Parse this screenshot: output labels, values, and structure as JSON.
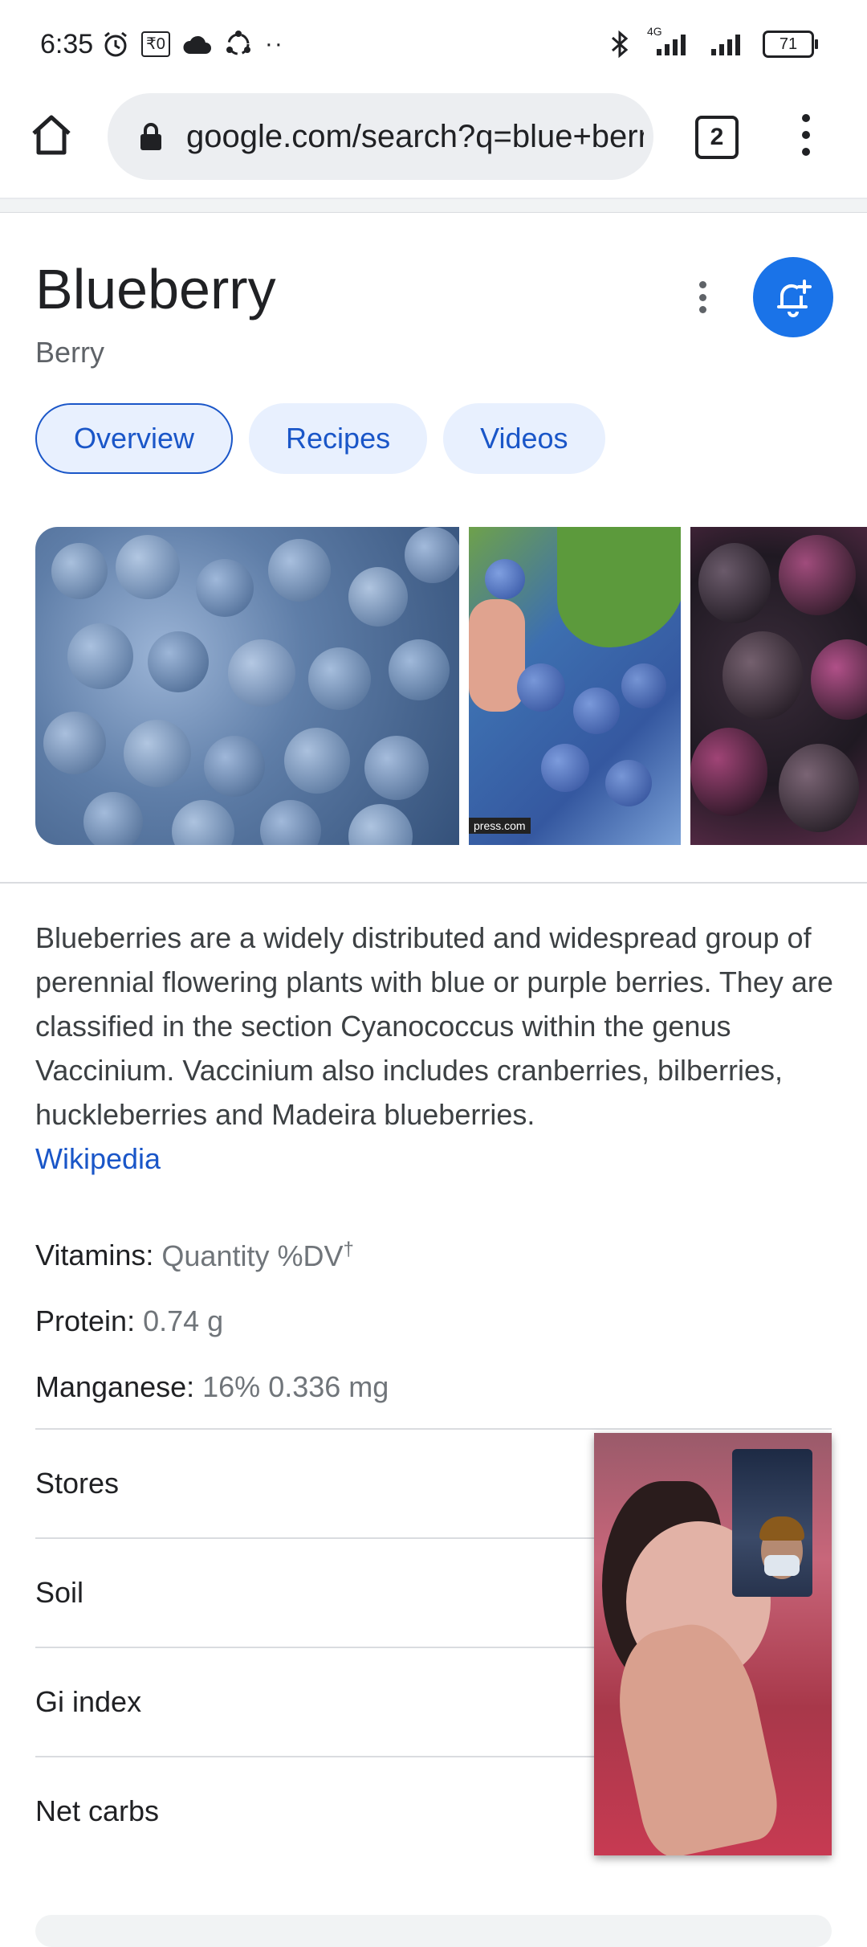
{
  "status_bar": {
    "time": "6:35",
    "icons_left": [
      "alarm-icon",
      "rupee-icon",
      "cloud-icon",
      "sync-icon",
      "more-dots-icon"
    ],
    "rupee_label": "₹0",
    "dots": "··",
    "network_label": "4G",
    "battery": "71"
  },
  "browser": {
    "url": "google.com/search?q=blue+berry",
    "tab_count": "2"
  },
  "knowledge_panel": {
    "title": "Blueberry",
    "subtitle": "Berry",
    "tabs": [
      {
        "label": "Overview",
        "active": true
      },
      {
        "label": "Recipes",
        "active": false
      },
      {
        "label": "Videos",
        "active": false
      }
    ],
    "image_watermark": "press.com",
    "description": "Blueberries are a widely distributed and widespread group of perennial flowering plants with blue or purple berries. They are classified in the section Cyanococcus within the genus Vaccinium. Vaccinium also includes cranberries, bilberries, huckleberries and Madeira blueberries.",
    "source_link": "Wikipedia",
    "facts": [
      {
        "label": "Vitamins:",
        "value": "Quantity %DV",
        "sup": "†"
      },
      {
        "label": "Protein:",
        "value": "0.74 g",
        "sup": ""
      },
      {
        "label": "Manganese:",
        "value": "16% 0.336 mg",
        "sup": ""
      }
    ],
    "expandable_rows": [
      "Stores",
      "Soil",
      "Gi index",
      "Net carbs"
    ]
  },
  "colors": {
    "accent_blue": "#1a73e8",
    "link_blue": "#1a56c8",
    "chip_bg": "#e8f0fe"
  }
}
